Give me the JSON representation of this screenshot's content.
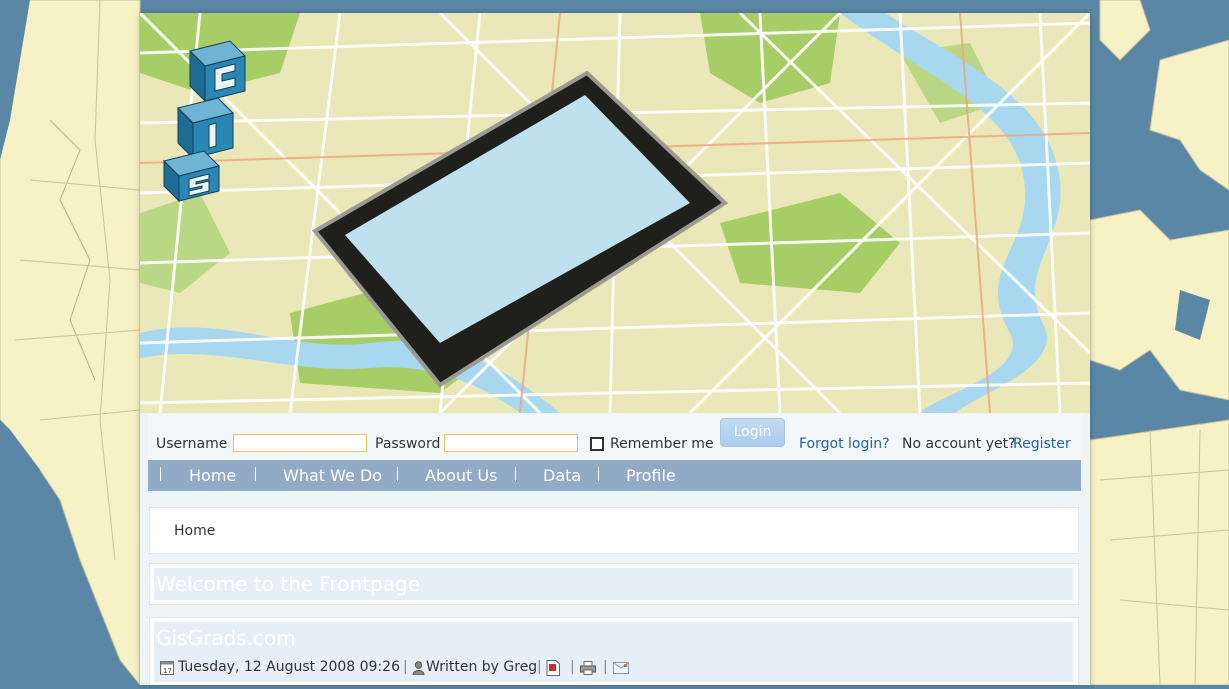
{
  "login": {
    "username_label": "Username",
    "username_value": "",
    "password_label": "Password",
    "password_value": "",
    "remember_label": "Remember me",
    "login_button": "Login",
    "forgot_link": "Forgot login?",
    "no_account_text": "No account yet?",
    "register_link": "Register"
  },
  "nav": {
    "items": [
      {
        "label": "Home"
      },
      {
        "label": "What We Do"
      },
      {
        "label": "About Us"
      },
      {
        "label": "Data"
      },
      {
        "label": "Profile"
      }
    ]
  },
  "breadcrumb": {
    "current": "Home"
  },
  "welcome": {
    "title": "Welcome to the Frontpage"
  },
  "article": {
    "title": "GisGrads.com",
    "date": "Tuesday, 12 August 2008 09:26",
    "author": "Written by Greg",
    "icons": [
      "calendar-icon",
      "user-icon",
      "pdf-icon",
      "print-icon",
      "email-icon"
    ]
  },
  "logo": {
    "letters": [
      "G",
      "I",
      "S"
    ]
  },
  "colors": {
    "nav_bg": "#91aac6",
    "link": "#1e62b0",
    "field_border": "#e8c35a",
    "login_button": "#a9cbee",
    "ocean": "#5b87a6",
    "land": "#f7f1c6"
  }
}
